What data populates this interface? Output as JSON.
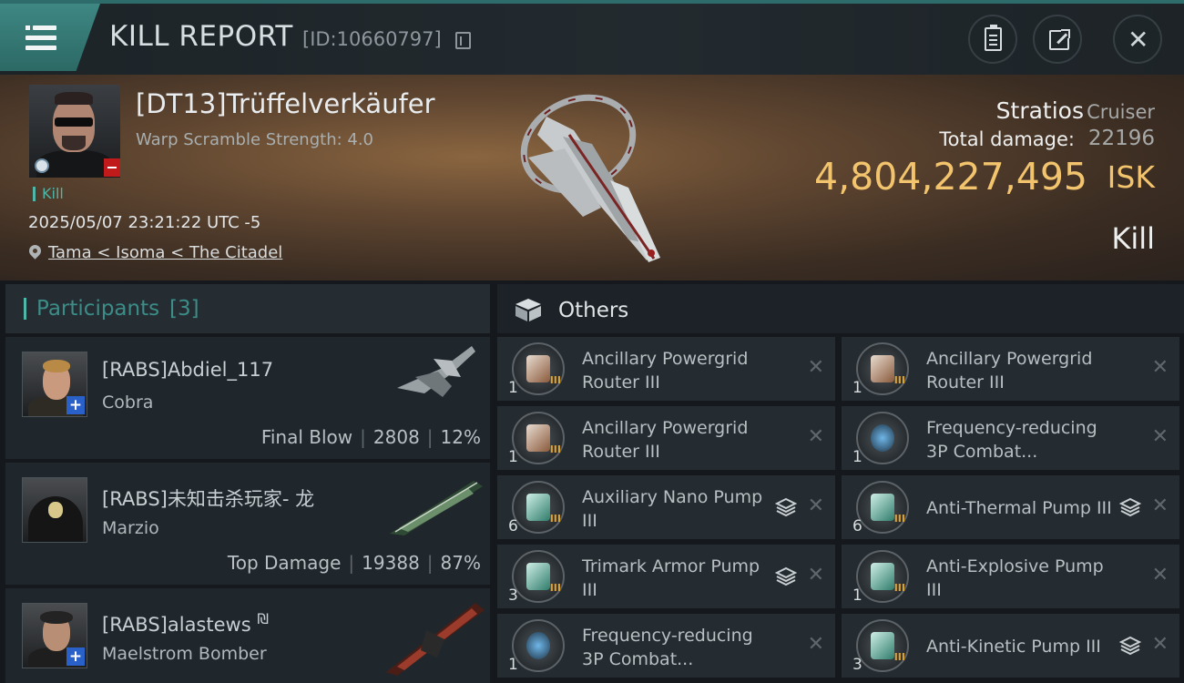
{
  "header": {
    "title": "KILL REPORT",
    "report_id": "[ID:10660797]"
  },
  "victim": {
    "name": "[DT13]Trüffelverkäufer",
    "subtitle": "Warp Scramble Strength: 4.0",
    "kill_tag": "Kill",
    "time": "2025/05/07 23:21:22 UTC -5",
    "location": "Tama < Isoma < The Citadel",
    "ship_name": "Stratios",
    "ship_class": "Cruiser",
    "damage_label": "Total damage:",
    "damage_value": "22196",
    "isk_value": "4,804,227,495",
    "isk_unit": "ISK",
    "result": "Kill"
  },
  "participants": {
    "label": "Participants",
    "count": "[3]",
    "rows": [
      {
        "name": "[RABS]Abdiel_117",
        "ship": "Cobra",
        "role": "Final Blow",
        "damage": "2808",
        "percent": "12%"
      },
      {
        "name": "[RABS]未知击杀玩家- 龙",
        "ship": "Marzio",
        "role": "Top Damage",
        "damage": "19388",
        "percent": "87%"
      },
      {
        "name": "[RABS]alastews",
        "mark": "₪",
        "ship": "Maelstrom Bomber"
      }
    ]
  },
  "others": {
    "label": "Others",
    "items": [
      {
        "qty": "1",
        "name": "Ancillary Powergrid Router III",
        "tier": "III",
        "icon": "powergrid-router-icon"
      },
      {
        "qty": "1",
        "name": "Ancillary Powergrid Router III",
        "tier": "III",
        "icon": "powergrid-router-icon"
      },
      {
        "qty": "1",
        "name": "Ancillary Powergrid Router III",
        "tier": "III",
        "icon": "powergrid-router-icon"
      },
      {
        "qty": "1",
        "name": "Frequency-reducing 3P Combat...",
        "tier": "",
        "icon": "combat-module-icon"
      },
      {
        "qty": "6",
        "name": "Auxiliary Nano Pump III",
        "tier": "III",
        "icon": "armor-pump-icon",
        "stacked": true
      },
      {
        "qty": "6",
        "name": "Anti-Thermal Pump III",
        "tier": "III",
        "icon": "armor-pump-icon",
        "stacked": true
      },
      {
        "qty": "3",
        "name": "Trimark Armor Pump III",
        "tier": "III",
        "icon": "armor-pump-icon",
        "stacked": true
      },
      {
        "qty": "1",
        "name": "Anti-Explosive Pump III",
        "tier": "III",
        "icon": "armor-pump-icon"
      },
      {
        "qty": "1",
        "name": "Frequency-reducing 3P Combat...",
        "tier": "",
        "icon": "combat-module-icon"
      },
      {
        "qty": "3",
        "name": "Anti-Kinetic Pump III",
        "tier": "III",
        "icon": "armor-pump-icon",
        "stacked": true
      }
    ]
  },
  "colors": {
    "accent_teal": "#4fb6a8",
    "isk_gold": "#f3c46e",
    "standing_red": "#c11a1a",
    "plus_blue": "#2a61c9"
  }
}
